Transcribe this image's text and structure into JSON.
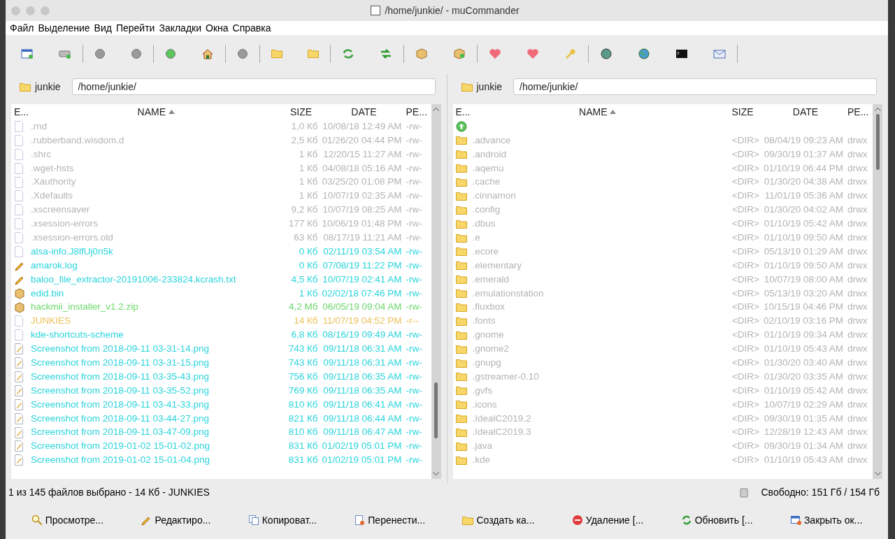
{
  "window": {
    "title": "/home/junkie/ - muCommander"
  },
  "menu": [
    "Файл",
    "Выделение",
    "Вид",
    "Перейти",
    "Закладки",
    "Окна",
    "Справка"
  ],
  "panels": [
    {
      "folder": "junkie",
      "path": "/home/junkie/",
      "columns": [
        "E...",
        "NAME",
        "SIZE",
        "DATE",
        "PE..."
      ],
      "rows": [
        {
          "kind": "hidden",
          "name": ".rnd",
          "size": "1,0 Кб",
          "date": "10/08/18 12:49 AM",
          "perm": "-rw-",
          "selected": false
        },
        {
          "kind": "hidden",
          "name": ".rubberband.wisdom.d",
          "size": "2,5 Кб",
          "date": "01/26/20 04:44 PM",
          "perm": "-rw-",
          "selected": false
        },
        {
          "kind": "hidden",
          "name": ".shrc",
          "size": "1 Кб",
          "date": "12/20/15 11:27 AM",
          "perm": "-rw-",
          "selected": false
        },
        {
          "kind": "hidden",
          "name": ".wget-hsts",
          "size": "1 Кб",
          "date": "04/08/18 05:16 AM",
          "perm": "-rw-",
          "selected": false
        },
        {
          "kind": "hidden",
          "name": ".Xauthority",
          "size": "1 Кб",
          "date": "03/25/20 01:08 PM",
          "perm": "-rw-",
          "selected": false
        },
        {
          "kind": "hidden",
          "name": ".Xdefaults",
          "size": "1 Кб",
          "date": "10/07/19 02:35 AM",
          "perm": "-rw-",
          "selected": false
        },
        {
          "kind": "hidden",
          "name": ".xscreensaver",
          "size": "9,2 Кб",
          "date": "10/07/19 08:25 AM",
          "perm": "-rw-",
          "selected": false
        },
        {
          "kind": "hidden",
          "name": ".xsession-errors",
          "size": "177 Кб",
          "date": "10/06/19 01:48 PM",
          "perm": "-rw-",
          "selected": false
        },
        {
          "kind": "hidden",
          "name": ".xsession-errors.old",
          "size": "63 Кб",
          "date": "08/17/19 11:21 AM",
          "perm": "-rw-",
          "selected": false
        },
        {
          "kind": "file",
          "name": "alsa-info.J8lfUj0n5k",
          "size": "0 Кб",
          "date": "02/11/19 03:54 AM",
          "perm": "-rw-",
          "selected": false
        },
        {
          "kind": "text",
          "name": "amarok.log",
          "size": "0 Кб",
          "date": "07/08/19 11:22 PM",
          "perm": "-rw-",
          "selected": false
        },
        {
          "kind": "text",
          "name": "baloo_file_extractor-20191006-233824.kcrash.txt",
          "size": "4,5 Кб",
          "date": "10/07/19 02:41 AM",
          "perm": "-rw-",
          "selected": false
        },
        {
          "kind": "binary",
          "name": "edid.bin",
          "size": "1 Кб",
          "date": "02/02/18 07:46 PM",
          "perm": "-rw-",
          "selected": false
        },
        {
          "kind": "archive",
          "name": "hackmii_installer_v1.2.zip",
          "size": "4,2 Мб",
          "date": "06/05/19 09:04 AM",
          "perm": "-rw-",
          "selected": false
        },
        {
          "kind": "file",
          "name": "JUNKIES",
          "size": "14 Кб",
          "date": "11/07/19 04:52 PM",
          "perm": "-r--",
          "selected": true
        },
        {
          "kind": "file",
          "name": "kde-shortcuts-scheme",
          "size": "6,8 Кб",
          "date": "08/16/19 09:49 AM",
          "perm": "-rw-",
          "selected": false
        },
        {
          "kind": "image",
          "name": "Screenshot from 2018-09-11 03-31-14.png",
          "size": "743 Кб",
          "date": "09/11/18 06:31 AM",
          "perm": "-rw-",
          "selected": false
        },
        {
          "kind": "image",
          "name": "Screenshot from 2018-09-11 03-31-15.png",
          "size": "743 Кб",
          "date": "09/11/18 06:31 AM",
          "perm": "-rw-",
          "selected": false
        },
        {
          "kind": "image",
          "name": "Screenshot from 2018-09-11 03-35-43.png",
          "size": "756 Кб",
          "date": "09/11/18 06:35 AM",
          "perm": "-rw-",
          "selected": false
        },
        {
          "kind": "image",
          "name": "Screenshot from 2018-09-11 03-35-52.png",
          "size": "769 Кб",
          "date": "09/11/18 06:35 AM",
          "perm": "-rw-",
          "selected": false
        },
        {
          "kind": "image",
          "name": "Screenshot from 2018-09-11 03-41-33.png",
          "size": "810 Кб",
          "date": "09/11/18 06:41 AM",
          "perm": "-rw-",
          "selected": false
        },
        {
          "kind": "image",
          "name": "Screenshot from 2018-09-11 03-44-27.png",
          "size": "821 Кб",
          "date": "09/11/18 06:44 AM",
          "perm": "-rw-",
          "selected": false
        },
        {
          "kind": "image",
          "name": "Screenshot from 2018-09-11 03-47-09.png",
          "size": "810 Кб",
          "date": "09/11/18 06:47 AM",
          "perm": "-rw-",
          "selected": false
        },
        {
          "kind": "image",
          "name": "Screenshot from 2019-01-02 15-01-02.png",
          "size": "831 Кб",
          "date": "01/02/19 05:01 PM",
          "perm": "-rw-",
          "selected": false
        },
        {
          "kind": "image",
          "name": "Screenshot from 2019-01-02 15-01-04.png",
          "size": "831 Кб",
          "date": "01/02/19 05:01 PM",
          "perm": "-rw-",
          "selected": false
        }
      ]
    },
    {
      "folder": "junkie",
      "path": "/home/junkie/",
      "columns": [
        "E...",
        "NAME",
        "SIZE",
        "DATE",
        "PE..."
      ],
      "rows": [
        {
          "kind": "parent"
        },
        {
          "kind": "folder",
          "name": ".advance",
          "size": "<DIR>",
          "date": "08/04/19 09:23 AM",
          "perm": "drwx",
          "selected": false
        },
        {
          "kind": "folder",
          "name": ".android",
          "size": "<DIR>",
          "date": "09/30/19 01:37 AM",
          "perm": "drwx",
          "selected": false
        },
        {
          "kind": "folder",
          "name": ".aqemu",
          "size": "<DIR>",
          "date": "01/10/19 06:44 PM",
          "perm": "drwx",
          "selected": false
        },
        {
          "kind": "folder",
          "name": ".cache",
          "size": "<DIR>",
          "date": "01/30/20 04:38 AM",
          "perm": "drwx",
          "selected": false
        },
        {
          "kind": "folder",
          "name": ".cinnamon",
          "size": "<DIR>",
          "date": "11/01/19 05:36 AM",
          "perm": "drwx",
          "selected": false
        },
        {
          "kind": "folder",
          "name": ".config",
          "size": "<DIR>",
          "date": "01/30/20 04:02 AM",
          "perm": "drwx",
          "selected": false
        },
        {
          "kind": "folder",
          "name": ".dbus",
          "size": "<DIR>",
          "date": "01/10/19 05:42 AM",
          "perm": "drwx",
          "selected": false
        },
        {
          "kind": "folder",
          "name": ".e",
          "size": "<DIR>",
          "date": "01/10/19 09:50 AM",
          "perm": "drwx",
          "selected": false
        },
        {
          "kind": "folder",
          "name": ".ecore",
          "size": "<DIR>",
          "date": "05/13/19 01:29 AM",
          "perm": "drwx",
          "selected": false
        },
        {
          "kind": "folder",
          "name": ".elementary",
          "size": "<DIR>",
          "date": "01/10/19 09:50 AM",
          "perm": "drwx",
          "selected": false
        },
        {
          "kind": "folder",
          "name": ".emerald",
          "size": "<DIR>",
          "date": "10/07/19 08:00 AM",
          "perm": "drwx",
          "selected": false
        },
        {
          "kind": "folder",
          "name": ".emulationstation",
          "size": "<DIR>",
          "date": "05/13/19 03:20 AM",
          "perm": "drwx",
          "selected": false
        },
        {
          "kind": "folder",
          "name": ".fluxbox",
          "size": "<DIR>",
          "date": "10/15/19 04:46 PM",
          "perm": "drwx",
          "selected": false
        },
        {
          "kind": "folder",
          "name": ".fonts",
          "size": "<DIR>",
          "date": "02/10/19 03:16 PM",
          "perm": "drwx",
          "selected": false
        },
        {
          "kind": "folder",
          "name": ".gnome",
          "size": "<DIR>",
          "date": "01/10/19 09:34 AM",
          "perm": "drwx",
          "selected": false
        },
        {
          "kind": "folder",
          "name": ".gnome2",
          "size": "<DIR>",
          "date": "01/10/19 05:43 AM",
          "perm": "drwx",
          "selected": false
        },
        {
          "kind": "folder",
          "name": ".gnupg",
          "size": "<DIR>",
          "date": "01/30/20 03:40 AM",
          "perm": "drwx",
          "selected": false
        },
        {
          "kind": "folder",
          "name": ".gstreamer-0.10",
          "size": "<DIR>",
          "date": "01/30/20 03:35 AM",
          "perm": "drwx",
          "selected": false
        },
        {
          "kind": "folder",
          "name": ".gvfs",
          "size": "<DIR>",
          "date": "01/10/19 05:42 AM",
          "perm": "drwx",
          "selected": false
        },
        {
          "kind": "folder",
          "name": ".icons",
          "size": "<DIR>",
          "date": "10/07/19 02:29 AM",
          "perm": "drwx",
          "selected": false
        },
        {
          "kind": "folder",
          "name": ".IdealC2019.2",
          "size": "<DIR>",
          "date": "09/30/19 01:35 AM",
          "perm": "drwx",
          "selected": false
        },
        {
          "kind": "folder",
          "name": ".IdealC2019.3",
          "size": "<DIR>",
          "date": "12/28/19 12:43 AM",
          "perm": "drwx",
          "selected": false
        },
        {
          "kind": "folder",
          "name": ".java",
          "size": "<DIR>",
          "date": "09/30/19 01:34 AM",
          "perm": "drwx",
          "selected": false
        },
        {
          "kind": "folder",
          "name": ".kde",
          "size": "<DIR>",
          "date": "01/10/19 05:43 AM",
          "perm": "drwx",
          "selected": false
        }
      ]
    }
  ],
  "status": {
    "selection": "1 из 145 файлов выбрано - 14 Кб - JUNKIES",
    "free_space": "Свободно: 151 Гб / 154 Гб"
  },
  "buttons": [
    {
      "kind": "view",
      "label": "Просмотре..."
    },
    {
      "kind": "edit",
      "label": "Редактиро..."
    },
    {
      "kind": "copy",
      "label": "Копироват..."
    },
    {
      "kind": "move",
      "label": "Перенести..."
    },
    {
      "kind": "mkdir",
      "label": "Создать ка..."
    },
    {
      "kind": "delete",
      "label": "Удаление [..."
    },
    {
      "kind": "refresh",
      "label": "Обновить [..."
    },
    {
      "kind": "close",
      "label": "Закрыть ок..."
    }
  ]
}
